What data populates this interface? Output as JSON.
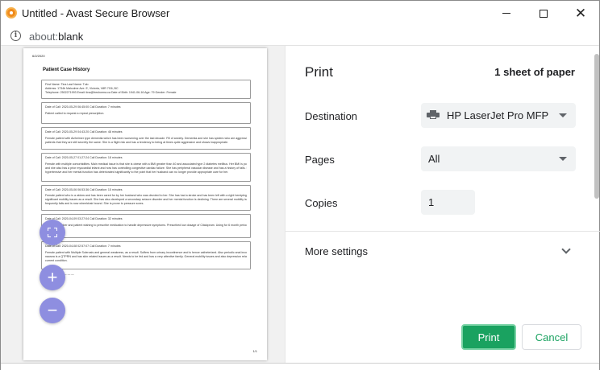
{
  "window": {
    "title": "Untitled - Avast Secure Browser",
    "minimize": "",
    "maximize": "",
    "close": "✕"
  },
  "address": {
    "scheme": "about:",
    "host": "blank"
  },
  "preview": {
    "date": "6/2/2020",
    "title": "Patient Case History",
    "patient_lines": [
      "First Name: Tina  Last Name: Tulo",
      "Address: 1734b Malcolme Ave. E, Victoria, V8R 7G6, BC",
      "Telephone: 2502271993  Email: tina@freshorma.ca  Date of Birth: 1941-06-16  Age: 79  Gender: Female"
    ],
    "calls": [
      {
        "header": "Date of Call: 2020-05-29 06:45:00  Call Duration: 7 minutes",
        "body": [
          "Patient called to request a repeat prescription."
        ]
      },
      {
        "header": "Date of Call: 2020-05-29 04:43:20  Call Duration: 48 minutes",
        "body": [
          "Female patient with Alzheimer type dementia which has been worsening over the last decade. Fill of anxiety. Dementia and she has spiders who are aggressive, but are",
          "patients that they are still secretly the same. She is a flight risk and has a tendency to being at times quite aggressive and shows inappropriate."
        ]
      },
      {
        "header": "Date of Call: 2020-05-27 01:27:24  Call Duration: 18 minutes",
        "body": [
          "Female with multiple comorbidities. Main medical issue is that she is obese with a BMI greater than 40 and associated type 2 diabetes mellitus. Her BMI is poorly controlled",
          "and she also has a prior myocardial infarct and now has controlling congestive cardiac failure. She has peripheral vascular disease and has a history of falls. She is",
          "hypertensive and her mental function has deteriorated significantly to the point that her husband can no longer provide appropriate care for her."
        ]
      },
      {
        "header": "Date of Call: 2020-05-06 06:53:36  Call Duration: 15 minutes",
        "body": [
          "Female patient who is a widow and has been cared for by her husband who was devoted to her. She has had a stroke and has been left with a right hemiplegia and has",
          "significant mobility issues as a result. She has also developed a secondary seizure disorder and her mental function is declining. There are several mobility issues and she",
          "frequently falls and is now wheelchair bound. She is prone to pressure sores."
        ]
      },
      {
        "header": "Date of Call: 2020-04-09 03:27:04  Call Duration: 32 minutes",
        "body": [
          "... family member and patient wishing to prescribe medication to handle depressive symptoms. Prescribed low dosage of Citalopram. Using for 6 month period to"
        ]
      },
      {
        "header": "Date of Call: 2020-04-08 02:57:07  Call Duration: 7 minutes",
        "body": [
          "Female patient with Multiple Sclerosis and general weakness, as a result. Suffers from urinary incontinence and is hence catheterized. Also periodic anal incontinence and",
          "nausea is a QTPRN and has skin related issues as a result. Needs to be fed and has a very attentive family. General mobility issues and also depression related to her",
          "current condition."
        ]
      }
    ],
    "end_mark": "— — —",
    "page_num": "1/1"
  },
  "zoom": {
    "fit": "",
    "plus": "+",
    "minus": "−"
  },
  "print": {
    "title": "Print",
    "sheets": "1 sheet of paper",
    "destination_label": "Destination",
    "destination_value": "HP LaserJet Pro MFP",
    "pages_label": "Pages",
    "pages_value": "All",
    "copies_label": "Copies",
    "copies_value": "1",
    "more_settings": "More settings",
    "print_button": "Print",
    "cancel_button": "Cancel"
  },
  "colors": {
    "accent_green": "#1aa260",
    "zoom_button": "#8e8ee0"
  }
}
